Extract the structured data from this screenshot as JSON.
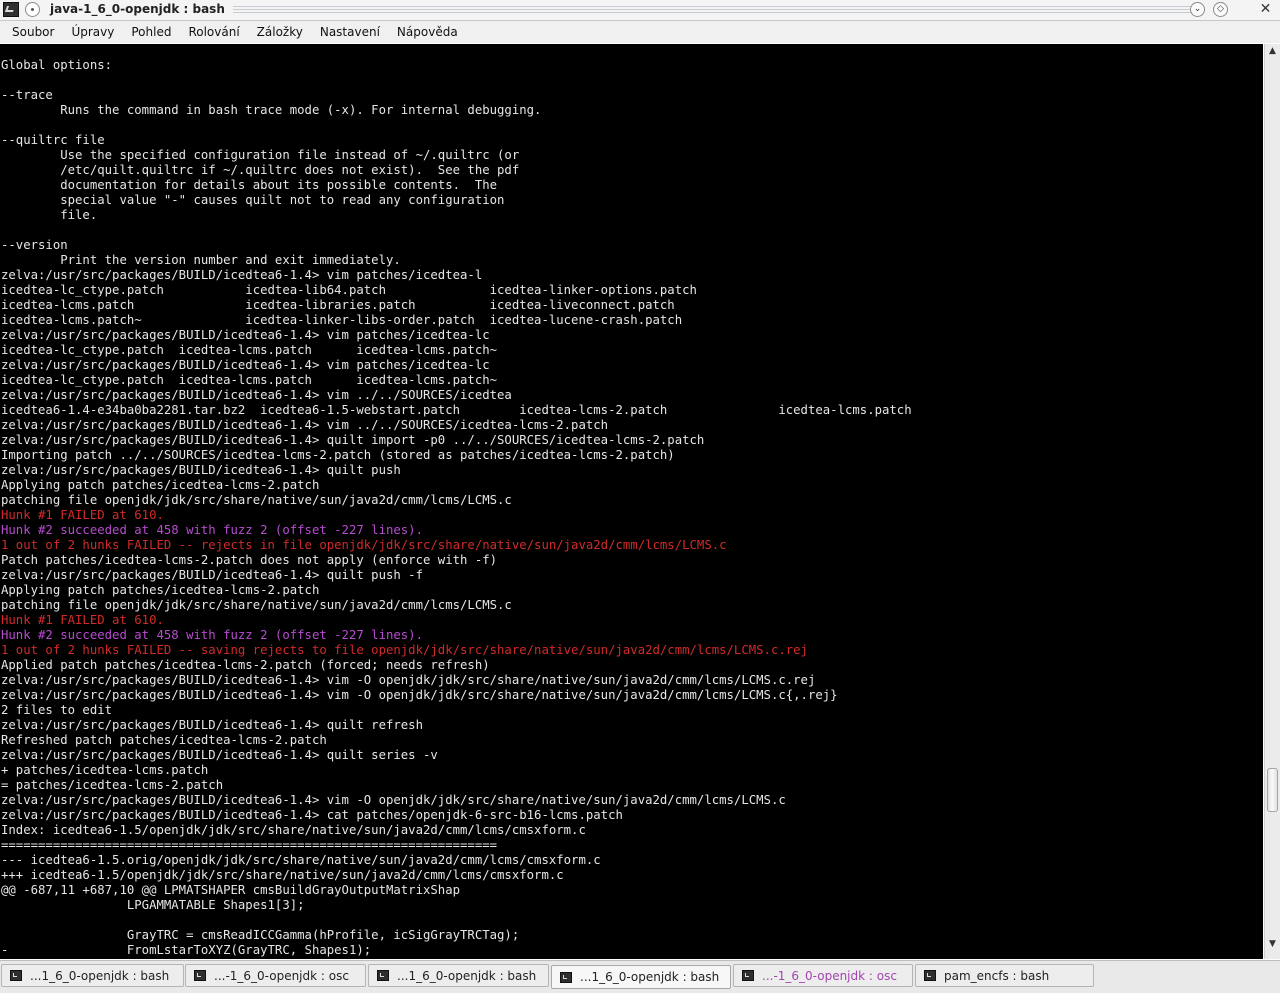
{
  "window": {
    "title": "java-1_6_0-openjdk : bash",
    "buttons": {
      "minimize": "⌄",
      "maximize": "◇",
      "close": "✕"
    }
  },
  "menu": [
    "Soubor",
    "Úpravy",
    "Pohled",
    "Rolování",
    "Záložky",
    "Nastavení",
    "Nápověda"
  ],
  "terminal": {
    "lines": [
      {
        "t": "Global options:"
      },
      {
        "t": ""
      },
      {
        "t": "--trace"
      },
      {
        "t": "        Runs the command in bash trace mode (-x). For internal debugging."
      },
      {
        "t": ""
      },
      {
        "t": "--quiltrc file"
      },
      {
        "t": "        Use the specified configuration file instead of ~/.quiltrc (or"
      },
      {
        "t": "        /etc/quilt.quiltrc if ~/.quiltrc does not exist).  See the pdf"
      },
      {
        "t": "        documentation for details about its possible contents.  The"
      },
      {
        "t": "        special value \"-\" causes quilt not to read any configuration"
      },
      {
        "t": "        file."
      },
      {
        "t": ""
      },
      {
        "t": "--version"
      },
      {
        "t": "        Print the version number and exit immediately."
      },
      {
        "t": "zelva:/usr/src/packages/BUILD/icedtea6-1.4> vim patches/icedtea-l"
      },
      {
        "t": "icedtea-lc_ctype.patch           icedtea-lib64.patch              icedtea-linker-options.patch"
      },
      {
        "t": "icedtea-lcms.patch               icedtea-libraries.patch          icedtea-liveconnect.patch"
      },
      {
        "t": "icedtea-lcms.patch~              icedtea-linker-libs-order.patch  icedtea-lucene-crash.patch"
      },
      {
        "t": "zelva:/usr/src/packages/BUILD/icedtea6-1.4> vim patches/icedtea-lc"
      },
      {
        "t": "icedtea-lc_ctype.patch  icedtea-lcms.patch      icedtea-lcms.patch~"
      },
      {
        "t": "zelva:/usr/src/packages/BUILD/icedtea6-1.4> vim patches/icedtea-lc"
      },
      {
        "t": "icedtea-lc_ctype.patch  icedtea-lcms.patch      icedtea-lcms.patch~"
      },
      {
        "t": "zelva:/usr/src/packages/BUILD/icedtea6-1.4> vim ../../SOURCES/icedtea"
      },
      {
        "t": "icedtea6-1.4-e34ba0ba2281.tar.bz2  icedtea6-1.5-webstart.patch        icedtea-lcms-2.patch               icedtea-lcms.patch"
      },
      {
        "t": "zelva:/usr/src/packages/BUILD/icedtea6-1.4> vim ../../SOURCES/icedtea-lcms-2.patch"
      },
      {
        "t": "zelva:/usr/src/packages/BUILD/icedtea6-1.4> quilt import -p0 ../../SOURCES/icedtea-lcms-2.patch"
      },
      {
        "t": "Importing patch ../../SOURCES/icedtea-lcms-2.patch (stored as patches/icedtea-lcms-2.patch)"
      },
      {
        "t": "zelva:/usr/src/packages/BUILD/icedtea6-1.4> quilt push"
      },
      {
        "t": "Applying patch patches/icedtea-lcms-2.patch"
      },
      {
        "t": "patching file openjdk/jdk/src/share/native/sun/java2d/cmm/lcms/LCMS.c"
      },
      {
        "t": "Hunk #1 FAILED at 610.",
        "c": "red"
      },
      {
        "t": "Hunk #2 succeeded at 458 with fuzz 2 (offset -227 lines).",
        "c": "mag"
      },
      {
        "t": "1 out of 2 hunks FAILED -- rejects in file openjdk/jdk/src/share/native/sun/java2d/cmm/lcms/LCMS.c",
        "c": "red"
      },
      {
        "t": "Patch patches/icedtea-lcms-2.patch does not apply (enforce with -f)"
      },
      {
        "t": "zelva:/usr/src/packages/BUILD/icedtea6-1.4> quilt push -f"
      },
      {
        "t": "Applying patch patches/icedtea-lcms-2.patch"
      },
      {
        "t": "patching file openjdk/jdk/src/share/native/sun/java2d/cmm/lcms/LCMS.c"
      },
      {
        "t": "Hunk #1 FAILED at 610.",
        "c": "red"
      },
      {
        "t": "Hunk #2 succeeded at 458 with fuzz 2 (offset -227 lines).",
        "c": "mag"
      },
      {
        "t": "1 out of 2 hunks FAILED -- saving rejects to file openjdk/jdk/src/share/native/sun/java2d/cmm/lcms/LCMS.c.rej",
        "c": "red"
      },
      {
        "t": "Applied patch patches/icedtea-lcms-2.patch (forced; needs refresh)"
      },
      {
        "t": "zelva:/usr/src/packages/BUILD/icedtea6-1.4> vim -O openjdk/jdk/src/share/native/sun/java2d/cmm/lcms/LCMS.c.rej"
      },
      {
        "t": "zelva:/usr/src/packages/BUILD/icedtea6-1.4> vim -O openjdk/jdk/src/share/native/sun/java2d/cmm/lcms/LCMS.c{,.rej}"
      },
      {
        "t": "2 files to edit"
      },
      {
        "t": "zelva:/usr/src/packages/BUILD/icedtea6-1.4> quilt refresh"
      },
      {
        "t": "Refreshed patch patches/icedtea-lcms-2.patch"
      },
      {
        "t": "zelva:/usr/src/packages/BUILD/icedtea6-1.4> quilt series -v"
      },
      {
        "t": "+ patches/icedtea-lcms.patch"
      },
      {
        "t": "= patches/icedtea-lcms-2.patch"
      },
      {
        "t": "zelva:/usr/src/packages/BUILD/icedtea6-1.4> vim -O openjdk/jdk/src/share/native/sun/java2d/cmm/lcms/LCMS.c"
      },
      {
        "t": "zelva:/usr/src/packages/BUILD/icedtea6-1.4> cat patches/openjdk-6-src-b16-lcms.patch"
      },
      {
        "t": "Index: icedtea6-1.5/openjdk/jdk/src/share/native/sun/java2d/cmm/lcms/cmsxform.c"
      },
      {
        "t": "==================================================================="
      },
      {
        "t": "--- icedtea6-1.5.orig/openjdk/jdk/src/share/native/sun/java2d/cmm/lcms/cmsxform.c"
      },
      {
        "t": "+++ icedtea6-1.5/openjdk/jdk/src/share/native/sun/java2d/cmm/lcms/cmsxform.c"
      },
      {
        "t": "@@ -687,11 +687,10 @@ LPMATSHAPER cmsBuildGrayOutputMatrixShap"
      },
      {
        "t": "                 LPGAMMATABLE Shapes1[3];"
      },
      {
        "t": ""
      },
      {
        "t": "                 GrayTRC = cmsReadICCGamma(hProfile, icSigGrayTRCTag);"
      },
      {
        "t": "-                FromLstarToXYZ(GrayTRC, Shapes1);"
      }
    ],
    "colors": {
      "red": "#d22a2a",
      "magenta": "#b84bd0",
      "text": "#e6e6e6",
      "background": "#000000"
    }
  },
  "scrollbar": {
    "up": "▲",
    "down": "▼",
    "position": 0.85
  },
  "tabs": [
    {
      "label": "...1_6_0-openjdk : bash"
    },
    {
      "label": "...-1_6_0-openjdk : osc"
    },
    {
      "label": "...1_6_0-openjdk : bash"
    },
    {
      "label": "...1_6_0-openjdk : bash",
      "active": true
    },
    {
      "label": "...-1_6_0-openjdk : osc",
      "alert": true
    },
    {
      "label": "pam_encfs : bash"
    }
  ]
}
